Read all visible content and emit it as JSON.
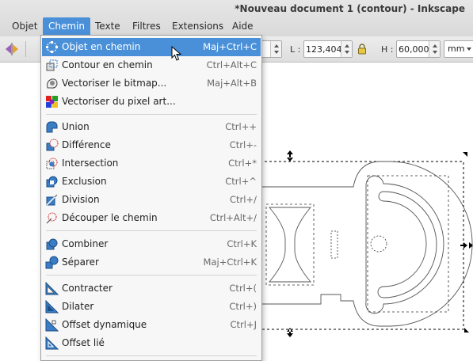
{
  "window": {
    "title": "*Nouveau document 1 (contour) - Inkscape"
  },
  "menubar": {
    "items": [
      {
        "label": "Objet"
      },
      {
        "label": "Chemin",
        "active": true
      },
      {
        "label": "Texte"
      },
      {
        "label": "Filtres"
      },
      {
        "label": "Extensions"
      },
      {
        "label": "Aide"
      }
    ]
  },
  "toolbar": {
    "x_value": "",
    "width_label": "L :",
    "width_value": "123,404",
    "height_label": "H :",
    "height_value": "60,000",
    "unit": "mm"
  },
  "path_menu": {
    "items": [
      {
        "label": "Objet en chemin",
        "shortcut": "Maj+Ctrl+C",
        "icon": "object-to-path-icon",
        "highlighted": true
      },
      {
        "label": "Contour en chemin",
        "shortcut": "Ctrl+Alt+C",
        "icon": "stroke-to-path-icon"
      },
      {
        "label": "Vectoriser le bitmap...",
        "shortcut": "Maj+Alt+B",
        "icon": "trace-bitmap-icon"
      },
      {
        "label": "Vectoriser du pixel art...",
        "shortcut": "",
        "icon": "trace-pixel-art-icon"
      },
      {
        "label": "Union",
        "shortcut": "Ctrl++",
        "icon": "union-icon"
      },
      {
        "label": "Différence",
        "shortcut": "Ctrl+-",
        "icon": "difference-icon"
      },
      {
        "label": "Intersection",
        "shortcut": "Ctrl+*",
        "icon": "intersection-icon"
      },
      {
        "label": "Exclusion",
        "shortcut": "Ctrl+^",
        "icon": "exclusion-icon"
      },
      {
        "label": "Division",
        "shortcut": "Ctrl+/",
        "icon": "division-icon"
      },
      {
        "label": "Découper le chemin",
        "shortcut": "Ctrl+Alt+/",
        "icon": "cut-path-icon"
      },
      {
        "label": "Combiner",
        "shortcut": "Ctrl+K",
        "icon": "combine-icon"
      },
      {
        "label": "Séparer",
        "shortcut": "Maj+Ctrl+K",
        "icon": "break-apart-icon"
      },
      {
        "label": "Contracter",
        "shortcut": "Ctrl+(",
        "icon": "inset-icon"
      },
      {
        "label": "Dilater",
        "shortcut": "Ctrl+)",
        "icon": "outset-icon"
      },
      {
        "label": "Offset dynamique",
        "shortcut": "Ctrl+J",
        "icon": "dynamic-offset-icon"
      },
      {
        "label": "Offset lié",
        "shortcut": "",
        "icon": "linked-offset-icon"
      }
    ]
  },
  "colors": {
    "highlight": "#4a90d9",
    "menu_bg": "#f7f7f7",
    "icon_blue": "#3b7dc4"
  }
}
